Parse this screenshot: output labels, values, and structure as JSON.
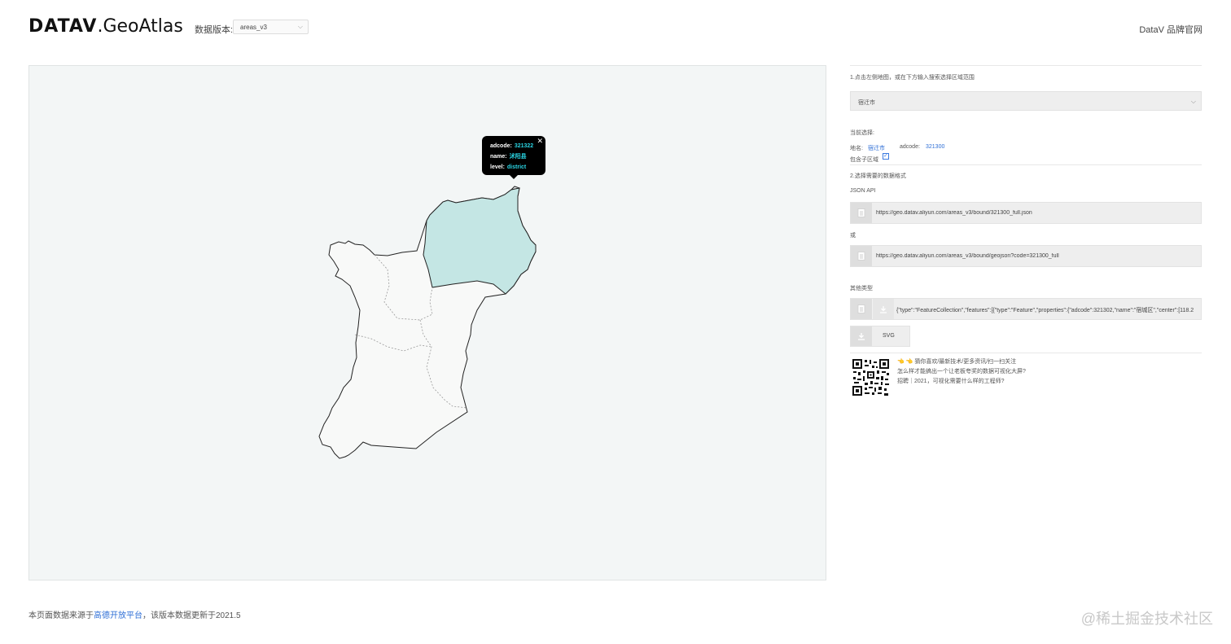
{
  "header": {
    "logo_bold": "DATAV",
    "logo_light": ".GeoAtlas",
    "version_label": "数据版本:",
    "version_value": "areas_v3",
    "brand_link": "DataV 品牌官网"
  },
  "map": {
    "tooltip": {
      "adcode_label": "adcode:",
      "adcode_value": "321322",
      "name_label": "name:",
      "name_value": "沭阳县",
      "level_label": "level:",
      "level_value": "district",
      "close_glyph": "✕"
    },
    "highlight_color": "#c4e6e4",
    "region_fill": "#f8f9f8",
    "background": "#f3f6f6"
  },
  "panel": {
    "step1": "1.点击左侧地图，或在下方输入搜索选择区域范围",
    "region_select": "宿迁市",
    "current_label": "当前选择:",
    "name_label": "地名:",
    "name_value": "宿迁市",
    "adcode_label": "adcode:",
    "adcode_value": "321300",
    "include_sub": "包含子区域",
    "step2": "2.选择需要的数据格式",
    "json_api_label": "JSON API",
    "url1": "https://geo.datav.aliyun.com/areas_v3/bound/321300_full.json",
    "or_label": "或",
    "url2": "https://geo.datav.aliyun.com/areas_v3/bound/geojson?code=321300_full",
    "other_label": "其他类型",
    "geojson_text": "{\"type\":\"FeatureCollection\",\"features\":[{\"type\":\"Feature\",\"properties\":{\"adcode\":321302,\"name\":\"宿城区\",\"center\":[118.2",
    "svg_label": "SVG",
    "promo": [
      "👈 👈 猜你喜欢/最新技术/更多资讯/扫一扫关注",
      "怎么样才能搞出一个让老板夸奖的数据可视化大屏?",
      "招聘｜2021，可视化需要什么样的工程师?"
    ]
  },
  "footer": {
    "prefix": "本页面数据来源于",
    "link": "高德开放平台",
    "suffix": "，该版本数据更新于2021.5"
  },
  "watermark": "@稀土掘金技术社区"
}
